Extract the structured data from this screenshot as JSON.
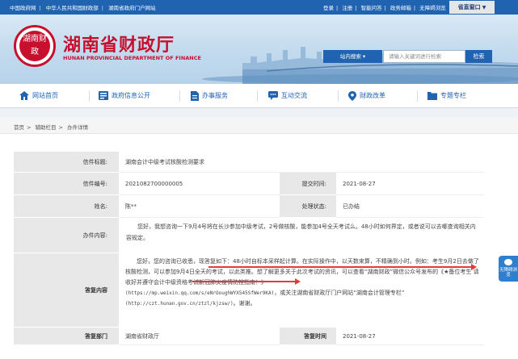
{
  "topbar": {
    "links_left": [
      "中国政府网",
      "中华人民共和国财政部",
      "湖南省政府门户网站"
    ],
    "links_right": [
      "登录",
      "注册",
      "智能问答",
      "政务邮箱",
      "无障碍浏览"
    ],
    "province_window": "省直窗口"
  },
  "header": {
    "logo_text": "湖南财政",
    "brand_cn": "湖南省财政厅",
    "brand_en": "HUNAN PROVINCIAL DEPARTMENT OF FINANCE",
    "search_scope": "站内搜索",
    "search_placeholder": "请输入关键词进行检索",
    "search_button": "检索"
  },
  "nav": {
    "items": [
      {
        "label": "网站首页",
        "icon": "home-icon"
      },
      {
        "label": "政府信息公开",
        "icon": "info-icon"
      },
      {
        "label": "办事服务",
        "icon": "document-icon"
      },
      {
        "label": "互动交流",
        "icon": "chat-icon"
      },
      {
        "label": "财政改革",
        "icon": "location-icon"
      },
      {
        "label": "专题专栏",
        "icon": "folder-icon"
      }
    ]
  },
  "breadcrumb": [
    "首页",
    "辅助栏目",
    "办件详情"
  ],
  "letter": {
    "title_label": "信件标题:",
    "title_value": "湖南会计中级考试核酸检测要求",
    "number_label": "信件编号:",
    "number_value": "2021082700000005",
    "submit_time_label": "提交时间:",
    "submit_time_value": "2021-08-27",
    "name_label": "姓名:",
    "name_value": "陈**",
    "status_label": "处理状态:",
    "status_value": "已办结",
    "content_label": "办件内容:",
    "content_value": "您好，我想咨询一下9月4号将在长沙参加中级考试，2号做核酸，能参加4号全天考试么。48小时如何界定，或者说可以去哪查询相关内容规定。",
    "reply_label": "答复内容",
    "reply_line1": "您好，您的咨询已收悉，现答复如下：48小时自标本采样起计算。在实际操作中，以天数来算，不精确到小时。例如：考生9月2日去做了核酸检测，可以参加9月4日全天的考试，以此类推。想了解更多关于此次考试的资讯，可以查看“湖南财政”微信公众号发布的《★备位考生 请收好并遵守会计中级资格考试新冠肺炎疫情防控指南！》",
    "reply_url1": "(https://mp.weixin.qq.com/s/eNrOoughWYX545SfWer9KA)",
    "reply_mid": "，或关注湖南省财政厅门户网站“湖南会计管理专栏”",
    "reply_url2": "(http://czt.hunan.gov.cn/ztzl/kjzsw/)",
    "reply_end": "。谢谢。",
    "dept_label": "答复部门",
    "dept_value": "湖南省财政厅",
    "reply_time_label": "答复时间",
    "reply_time_value": "2021-08-27"
  },
  "floating": {
    "label": "无障碍浏览"
  },
  "colors": {
    "primary_blue": "#1f63b1",
    "brand_red": "#c8102e",
    "annotation_red": "#e23b3b"
  }
}
